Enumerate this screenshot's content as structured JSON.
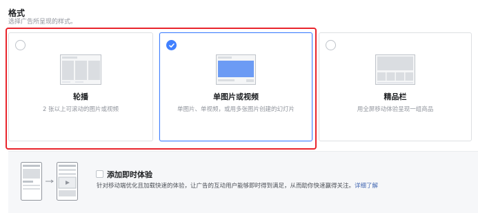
{
  "format": {
    "title": "格式",
    "subtitle": "选择广告所呈现的样式。"
  },
  "cards": [
    {
      "title": "轮播",
      "desc": "2 张以上可滚动的图片或视频",
      "selected": false,
      "icon": "carousel-thumbnail"
    },
    {
      "title": "单图片或视频",
      "desc": "单图片、单视频，或用多张图片创建的幻灯片",
      "selected": true,
      "icon": "single-image-thumbnail"
    },
    {
      "title": "精品栏",
      "desc": "用全屏移动体验呈现一组商品",
      "selected": false,
      "icon": "collection-thumbnail"
    }
  ],
  "instant_experience": {
    "title": "添加即时体验",
    "desc": "针对移动端优化且加载快速的体验，让广告的互动用户能够即时得到满足，从而助你快速赢得关注。",
    "link": "详细了解",
    "checked": false
  },
  "colors": {
    "accent": "#4080ff",
    "highlight_frame": "#e8232b",
    "link": "#4267b2"
  }
}
